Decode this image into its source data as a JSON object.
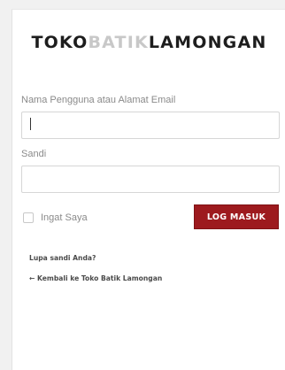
{
  "logo": {
    "part1": "TOKO",
    "part2": "BATIK",
    "part3": "LAMONGAN"
  },
  "form": {
    "username_label": "Nama Pengguna atau Alamat Email",
    "username_value": "",
    "password_label": "Sandi",
    "password_value": "",
    "remember_label": "Ingat Saya",
    "submit_label": "LOG MASUK"
  },
  "links": {
    "lost_password": "Lupa sandi Anda?",
    "back_to_site": "← Kembali ke Toko Batik Lamongan"
  },
  "colors": {
    "accent": "#9d1a1e",
    "logo_dark": "#1d1d1d",
    "logo_light": "#c8c8c8",
    "background": "#f1f1f1"
  }
}
